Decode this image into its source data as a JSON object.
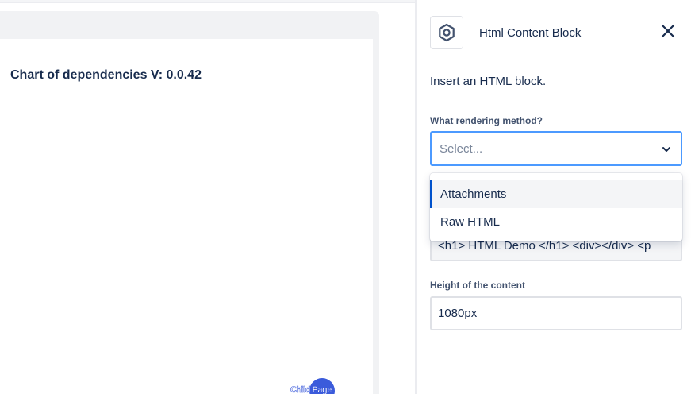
{
  "canvas": {
    "title": "Chart of dependencies V: 0.0.42",
    "child_page_label": "Child Page"
  },
  "panel": {
    "block_title": "Html Content Block",
    "block_icon": "hexagon-settings-icon",
    "close_icon": "close-icon",
    "description": "Insert an HTML block.",
    "rendering": {
      "label": "What rendering method?",
      "placeholder": "Select...",
      "options": [
        "Attachments",
        "Raw HTML"
      ],
      "highlighted_option": "Attachments"
    },
    "html_content": {
      "value": "<h1> HTML Demo </h1>  <div></div>  <p"
    },
    "height": {
      "label": "Height of the content",
      "value": "1080px"
    }
  },
  "colors": {
    "focus_border": "#4c9aff",
    "active_option_bar": "#0052cc",
    "text": "#172b4d",
    "child_page_badge": "#3b5bdb"
  }
}
